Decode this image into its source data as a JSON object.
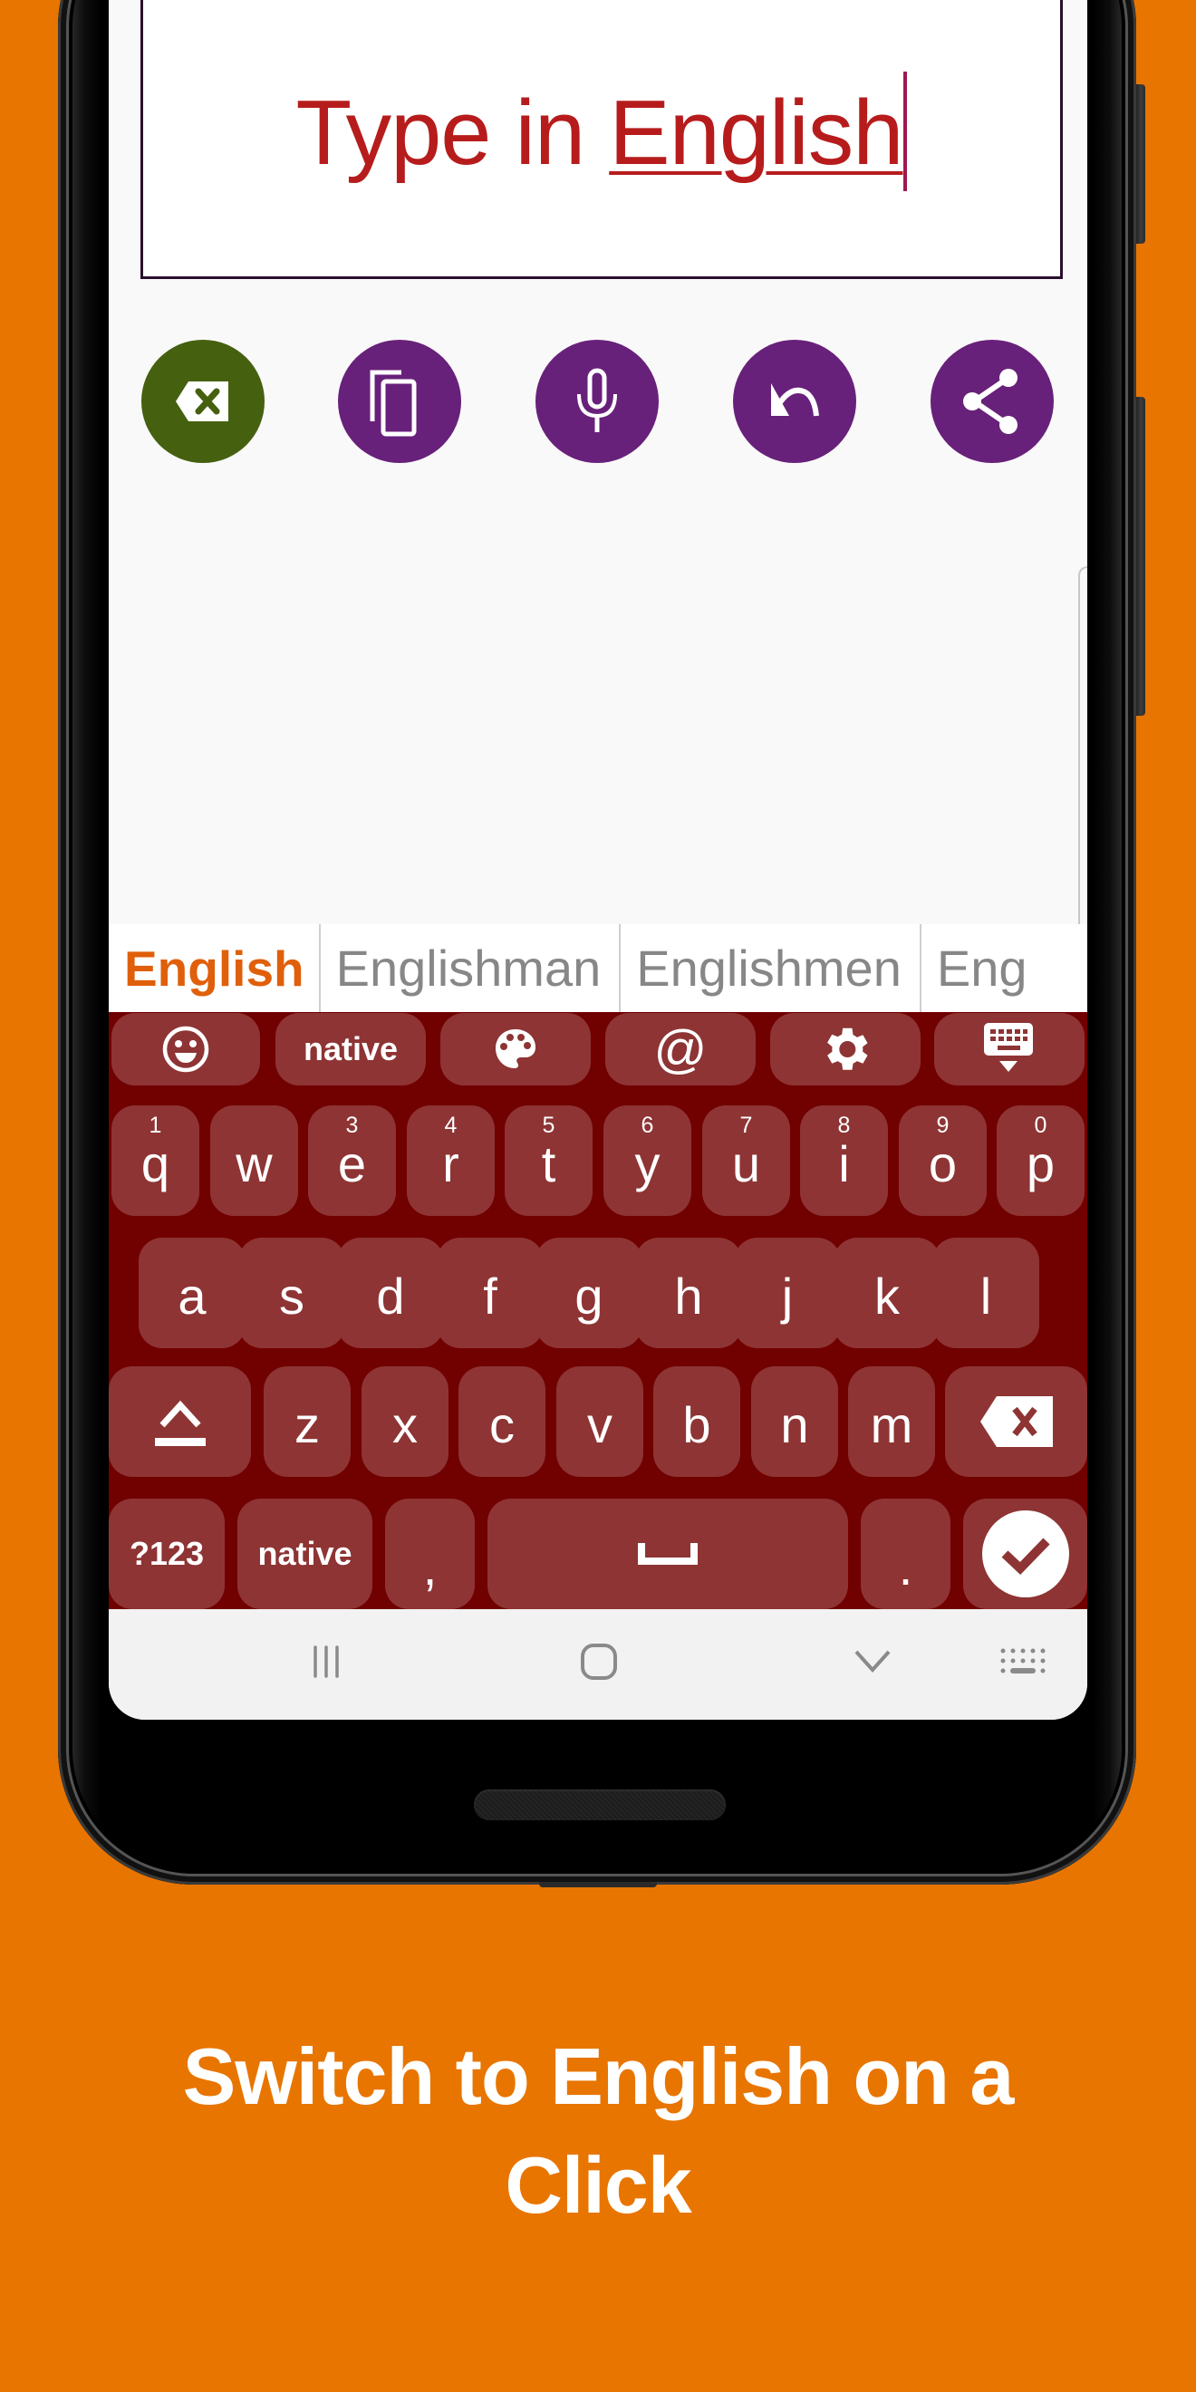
{
  "colors": {
    "background": "#e87500",
    "text_input_color": "#b71c1c",
    "clear_button": "#45600f",
    "action_button": "#68217a",
    "keyboard_background": "#710000",
    "key_background": "#8e3434",
    "suggestion_primary": "#e05f0b",
    "suggestion_secondary": "#878787"
  },
  "text_input": {
    "prefix": "Type in ",
    "composing_word": "English"
  },
  "actions": [
    {
      "name": "clear-text",
      "icon": "backspace-clear-icon"
    },
    {
      "name": "copy",
      "icon": "copy-icon"
    },
    {
      "name": "voice-input",
      "icon": "microphone-icon"
    },
    {
      "name": "undo",
      "icon": "undo-icon"
    },
    {
      "name": "share",
      "icon": "share-icon"
    }
  ],
  "suggestions": [
    "English",
    "Englishman",
    "Englishmen",
    "Eng"
  ],
  "keyboard": {
    "function_row": [
      {
        "icon": "emoji-icon"
      },
      {
        "label": "native"
      },
      {
        "icon": "palette-icon"
      },
      {
        "label": "@"
      },
      {
        "icon": "gear-icon"
      },
      {
        "icon": "hide-keyboard-icon"
      }
    ],
    "row1": [
      {
        "char": "q",
        "hint": "1"
      },
      {
        "char": "w",
        "hint": ""
      },
      {
        "char": "e",
        "hint": "3"
      },
      {
        "char": "r",
        "hint": "4"
      },
      {
        "char": "t",
        "hint": "5"
      },
      {
        "char": "y",
        "hint": "6"
      },
      {
        "char": "u",
        "hint": "7"
      },
      {
        "char": "i",
        "hint": "8"
      },
      {
        "char": "o",
        "hint": "9"
      },
      {
        "char": "p",
        "hint": "0"
      }
    ],
    "row2": [
      "a",
      "s",
      "d",
      "f",
      "g",
      "h",
      "j",
      "k",
      "l"
    ],
    "row3": [
      "z",
      "x",
      "c",
      "v",
      "b",
      "n",
      "m"
    ],
    "row4": {
      "symbols_label": "?123",
      "language_label": "native",
      "comma": ",",
      "period": "."
    }
  },
  "navbar": [
    "recent-apps",
    "home",
    "back",
    "keyboard-switch"
  ],
  "caption": {
    "line1": "Switch to English on a",
    "line2": "Click"
  }
}
